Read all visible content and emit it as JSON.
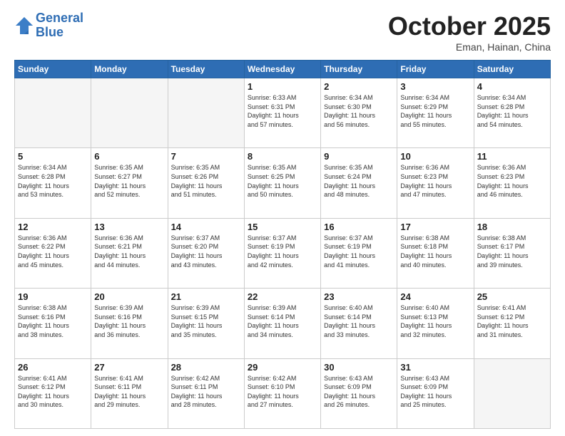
{
  "header": {
    "logo_line1": "General",
    "logo_line2": "Blue",
    "month_title": "October 2025",
    "location": "Eman, Hainan, China"
  },
  "weekdays": [
    "Sunday",
    "Monday",
    "Tuesday",
    "Wednesday",
    "Thursday",
    "Friday",
    "Saturday"
  ],
  "weeks": [
    [
      {
        "day": "",
        "info": ""
      },
      {
        "day": "",
        "info": ""
      },
      {
        "day": "",
        "info": ""
      },
      {
        "day": "1",
        "info": "Sunrise: 6:33 AM\nSunset: 6:31 PM\nDaylight: 11 hours\nand 57 minutes."
      },
      {
        "day": "2",
        "info": "Sunrise: 6:34 AM\nSunset: 6:30 PM\nDaylight: 11 hours\nand 56 minutes."
      },
      {
        "day": "3",
        "info": "Sunrise: 6:34 AM\nSunset: 6:29 PM\nDaylight: 11 hours\nand 55 minutes."
      },
      {
        "day": "4",
        "info": "Sunrise: 6:34 AM\nSunset: 6:28 PM\nDaylight: 11 hours\nand 54 minutes."
      }
    ],
    [
      {
        "day": "5",
        "info": "Sunrise: 6:34 AM\nSunset: 6:28 PM\nDaylight: 11 hours\nand 53 minutes."
      },
      {
        "day": "6",
        "info": "Sunrise: 6:35 AM\nSunset: 6:27 PM\nDaylight: 11 hours\nand 52 minutes."
      },
      {
        "day": "7",
        "info": "Sunrise: 6:35 AM\nSunset: 6:26 PM\nDaylight: 11 hours\nand 51 minutes."
      },
      {
        "day": "8",
        "info": "Sunrise: 6:35 AM\nSunset: 6:25 PM\nDaylight: 11 hours\nand 50 minutes."
      },
      {
        "day": "9",
        "info": "Sunrise: 6:35 AM\nSunset: 6:24 PM\nDaylight: 11 hours\nand 48 minutes."
      },
      {
        "day": "10",
        "info": "Sunrise: 6:36 AM\nSunset: 6:23 PM\nDaylight: 11 hours\nand 47 minutes."
      },
      {
        "day": "11",
        "info": "Sunrise: 6:36 AM\nSunset: 6:23 PM\nDaylight: 11 hours\nand 46 minutes."
      }
    ],
    [
      {
        "day": "12",
        "info": "Sunrise: 6:36 AM\nSunset: 6:22 PM\nDaylight: 11 hours\nand 45 minutes."
      },
      {
        "day": "13",
        "info": "Sunrise: 6:36 AM\nSunset: 6:21 PM\nDaylight: 11 hours\nand 44 minutes."
      },
      {
        "day": "14",
        "info": "Sunrise: 6:37 AM\nSunset: 6:20 PM\nDaylight: 11 hours\nand 43 minutes."
      },
      {
        "day": "15",
        "info": "Sunrise: 6:37 AM\nSunset: 6:19 PM\nDaylight: 11 hours\nand 42 minutes."
      },
      {
        "day": "16",
        "info": "Sunrise: 6:37 AM\nSunset: 6:19 PM\nDaylight: 11 hours\nand 41 minutes."
      },
      {
        "day": "17",
        "info": "Sunrise: 6:38 AM\nSunset: 6:18 PM\nDaylight: 11 hours\nand 40 minutes."
      },
      {
        "day": "18",
        "info": "Sunrise: 6:38 AM\nSunset: 6:17 PM\nDaylight: 11 hours\nand 39 minutes."
      }
    ],
    [
      {
        "day": "19",
        "info": "Sunrise: 6:38 AM\nSunset: 6:16 PM\nDaylight: 11 hours\nand 38 minutes."
      },
      {
        "day": "20",
        "info": "Sunrise: 6:39 AM\nSunset: 6:16 PM\nDaylight: 11 hours\nand 36 minutes."
      },
      {
        "day": "21",
        "info": "Sunrise: 6:39 AM\nSunset: 6:15 PM\nDaylight: 11 hours\nand 35 minutes."
      },
      {
        "day": "22",
        "info": "Sunrise: 6:39 AM\nSunset: 6:14 PM\nDaylight: 11 hours\nand 34 minutes."
      },
      {
        "day": "23",
        "info": "Sunrise: 6:40 AM\nSunset: 6:14 PM\nDaylight: 11 hours\nand 33 minutes."
      },
      {
        "day": "24",
        "info": "Sunrise: 6:40 AM\nSunset: 6:13 PM\nDaylight: 11 hours\nand 32 minutes."
      },
      {
        "day": "25",
        "info": "Sunrise: 6:41 AM\nSunset: 6:12 PM\nDaylight: 11 hours\nand 31 minutes."
      }
    ],
    [
      {
        "day": "26",
        "info": "Sunrise: 6:41 AM\nSunset: 6:12 PM\nDaylight: 11 hours\nand 30 minutes."
      },
      {
        "day": "27",
        "info": "Sunrise: 6:41 AM\nSunset: 6:11 PM\nDaylight: 11 hours\nand 29 minutes."
      },
      {
        "day": "28",
        "info": "Sunrise: 6:42 AM\nSunset: 6:11 PM\nDaylight: 11 hours\nand 28 minutes."
      },
      {
        "day": "29",
        "info": "Sunrise: 6:42 AM\nSunset: 6:10 PM\nDaylight: 11 hours\nand 27 minutes."
      },
      {
        "day": "30",
        "info": "Sunrise: 6:43 AM\nSunset: 6:09 PM\nDaylight: 11 hours\nand 26 minutes."
      },
      {
        "day": "31",
        "info": "Sunrise: 6:43 AM\nSunset: 6:09 PM\nDaylight: 11 hours\nand 25 minutes."
      },
      {
        "day": "",
        "info": ""
      }
    ]
  ]
}
